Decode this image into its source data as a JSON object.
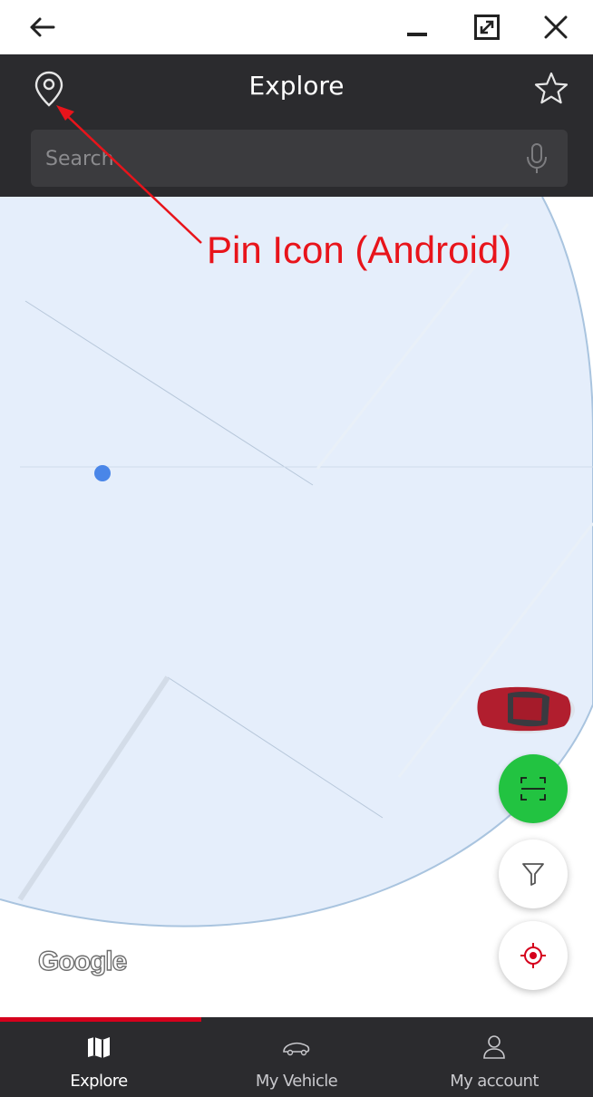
{
  "window": {
    "back_icon": "arrow-left-icon",
    "minimize_icon": "minimize-icon",
    "maximize_icon": "expand-icon",
    "close_icon": "close-icon"
  },
  "header": {
    "title": "Explore",
    "pin_icon": "map-pin-icon",
    "favorite_icon": "star-icon",
    "search_placeholder": "Search",
    "mic_icon": "microphone-icon"
  },
  "annotation": {
    "label": "Pin Icon (Android)",
    "color": "#e8141b"
  },
  "map": {
    "attribution": "Google",
    "fabs": [
      {
        "name": "scan",
        "icon": "scan-frame-icon",
        "color": "#22c341"
      },
      {
        "name": "filter",
        "icon": "filter-icon",
        "color": "#ffffff"
      },
      {
        "name": "locate",
        "icon": "crosshair-icon",
        "color": "#ffffff"
      }
    ]
  },
  "nav": {
    "active_color": "#d5001c",
    "items": [
      {
        "label": "Explore",
        "icon": "map-icon",
        "active": true
      },
      {
        "label": "My Vehicle",
        "icon": "car-icon",
        "active": false
      },
      {
        "label": "My account",
        "icon": "user-icon",
        "active": false
      }
    ]
  }
}
